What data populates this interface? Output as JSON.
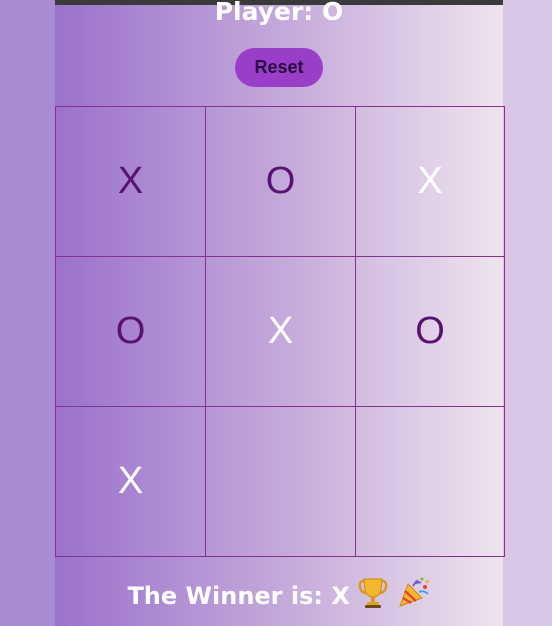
{
  "header": {
    "player_label": "Player: O"
  },
  "controls": {
    "reset_label": "Reset"
  },
  "board": {
    "cells": [
      {
        "mark": "X",
        "color": "#5b116f"
      },
      {
        "mark": "O",
        "color": "#5b116f"
      },
      {
        "mark": "X",
        "color": "#ffffff"
      },
      {
        "mark": "O",
        "color": "#5b116f"
      },
      {
        "mark": "X",
        "color": "#ffffff"
      },
      {
        "mark": "O",
        "color": "#5b116f"
      },
      {
        "mark": "X",
        "color": "#ffffff"
      },
      {
        "mark": "",
        "color": "#ffffff"
      },
      {
        "mark": "",
        "color": "#ffffff"
      }
    ],
    "grid_line_color": "#8a2e92"
  },
  "footer": {
    "winner_text": "The Winner is: X"
  },
  "icons": {
    "trophy": "trophy-icon",
    "party_popper": "party-popper-icon"
  },
  "colors": {
    "accent": "#9a3ec9",
    "mark_purple": "#5b116f",
    "mark_white": "#ffffff"
  }
}
